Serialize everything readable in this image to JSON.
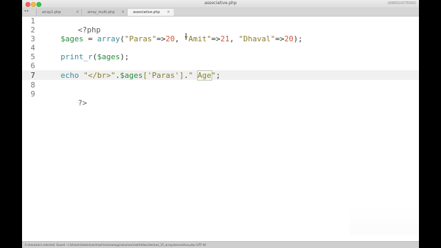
{
  "window": {
    "title": "associative.php",
    "unregistered": "UNREGISTERED"
  },
  "tabs": [
    {
      "label": "array1.php",
      "active": false
    },
    {
      "label": "array_multi.php",
      "active": false
    },
    {
      "label": "associative.php",
      "active": true
    }
  ],
  "nav_arrows": "◂ ▸",
  "tab_close": "×",
  "gutter": [
    "1",
    "2",
    "3",
    "4",
    "5",
    "6",
    "7",
    "8",
    "9"
  ],
  "code": {
    "l1": "<?php",
    "l3": {
      "var": "$ages",
      "eq": " = ",
      "func": "array",
      "open": "(",
      "s1": "\"Paras\"",
      "a1": "=>",
      "n1": "20",
      "c1": ", ",
      "s2": "\"Amit\"",
      "a2": "=>",
      "n2": "21",
      "c2": ", ",
      "s3": "\"Dhaval\"",
      "a3": "=>",
      "n3": "20",
      "close": ");"
    },
    "l5": {
      "func": "print_r",
      "open": "(",
      "var": "$ages",
      "close": ");"
    },
    "l7": {
      "kw": "echo",
      "sp": " ",
      "s1": "\"</br>\"",
      "dot1": ".",
      "var": "$ages",
      "idx": "['Paras']",
      "dot2": ".",
      "s2a": "\" ",
      "s2b": "Age",
      "s2c": "\"",
      "end": ";"
    },
    "l9": "?>"
  },
  "status": {
    "text": "0 characters selected. Saved ~/.bitnami/stackman/machines/xampp/volumes/root/htdocs/lecture_15_array/associative.php (UTF-8)"
  },
  "colors": {
    "background": "#ffffff",
    "variable": "#2b8a3e",
    "function": "#3b8a9a",
    "string": "#8a7a2a",
    "number": "#c75b39"
  }
}
